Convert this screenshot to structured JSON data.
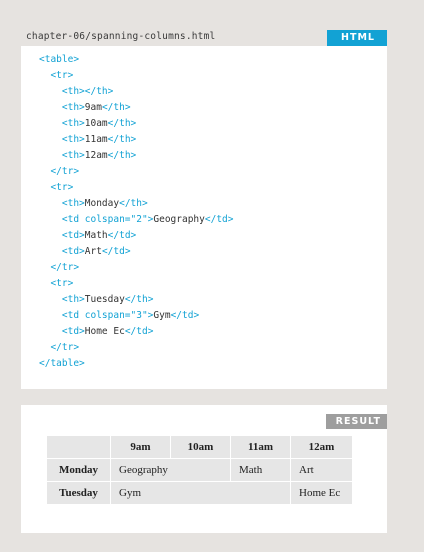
{
  "code_panel": {
    "file_path": "chapter-06/spanning-columns.html",
    "badge": "HTML",
    "lines": [
      [
        {
          "t": "<table>",
          "k": "tag"
        }
      ],
      [
        {
          "t": "  <tr>",
          "k": "tag"
        }
      ],
      [
        {
          "t": "    <th></th>",
          "k": "tag"
        }
      ],
      [
        {
          "t": "    <th>",
          "k": "tag"
        },
        {
          "t": "9am",
          "k": "txt"
        },
        {
          "t": "</th>",
          "k": "tag"
        }
      ],
      [
        {
          "t": "    <th>",
          "k": "tag"
        },
        {
          "t": "10am",
          "k": "txt"
        },
        {
          "t": "</th>",
          "k": "tag"
        }
      ],
      [
        {
          "t": "    <th>",
          "k": "tag"
        },
        {
          "t": "11am",
          "k": "txt"
        },
        {
          "t": "</th>",
          "k": "tag"
        }
      ],
      [
        {
          "t": "    <th>",
          "k": "tag"
        },
        {
          "t": "12am",
          "k": "txt"
        },
        {
          "t": "</th>",
          "k": "tag"
        }
      ],
      [
        {
          "t": "  </tr>",
          "k": "tag"
        }
      ],
      [
        {
          "t": "  <tr>",
          "k": "tag"
        }
      ],
      [
        {
          "t": "    <th>",
          "k": "tag"
        },
        {
          "t": "Monday",
          "k": "txt"
        },
        {
          "t": "</th>",
          "k": "tag"
        }
      ],
      [
        {
          "t": "    <td colspan=\"2\">",
          "k": "tag"
        },
        {
          "t": "Geography",
          "k": "txt"
        },
        {
          "t": "</td>",
          "k": "tag"
        }
      ],
      [
        {
          "t": "    <td>",
          "k": "tag"
        },
        {
          "t": "Math",
          "k": "txt"
        },
        {
          "t": "</td>",
          "k": "tag"
        }
      ],
      [
        {
          "t": "    <td>",
          "k": "tag"
        },
        {
          "t": "Art",
          "k": "txt"
        },
        {
          "t": "</td>",
          "k": "tag"
        }
      ],
      [
        {
          "t": "  </tr>",
          "k": "tag"
        }
      ],
      [
        {
          "t": "  <tr>",
          "k": "tag"
        }
      ],
      [
        {
          "t": "    <th>",
          "k": "tag"
        },
        {
          "t": "Tuesday",
          "k": "txt"
        },
        {
          "t": "</th>",
          "k": "tag"
        }
      ],
      [
        {
          "t": "    <td colspan=\"3\">",
          "k": "tag"
        },
        {
          "t": "Gym",
          "k": "txt"
        },
        {
          "t": "</td>",
          "k": "tag"
        }
      ],
      [
        {
          "t": "    <td>",
          "k": "tag"
        },
        {
          "t": "Home Ec",
          "k": "txt"
        },
        {
          "t": "</td>",
          "k": "tag"
        }
      ],
      [
        {
          "t": "  </tr>",
          "k": "tag"
        }
      ],
      [
        {
          "t": "</table>",
          "k": "tag"
        }
      ]
    ]
  },
  "result_panel": {
    "badge": "RESULT",
    "table": {
      "header": [
        "",
        "9am",
        "10am",
        "11am",
        "12am"
      ],
      "rows": [
        {
          "label": "Monday",
          "cells": [
            {
              "text": "Geography",
              "colspan": 2
            },
            {
              "text": "Math",
              "colspan": 1
            },
            {
              "text": "Art",
              "colspan": 1
            }
          ]
        },
        {
          "label": "Tuesday",
          "cells": [
            {
              "text": "Gym",
              "colspan": 3
            },
            {
              "text": "Home Ec",
              "colspan": 1
            }
          ]
        }
      ]
    }
  },
  "colors": {
    "tag": "#12a2d4",
    "text": "#333333",
    "html_badge": "#12a2d4",
    "result_badge": "#9e9e9e"
  }
}
